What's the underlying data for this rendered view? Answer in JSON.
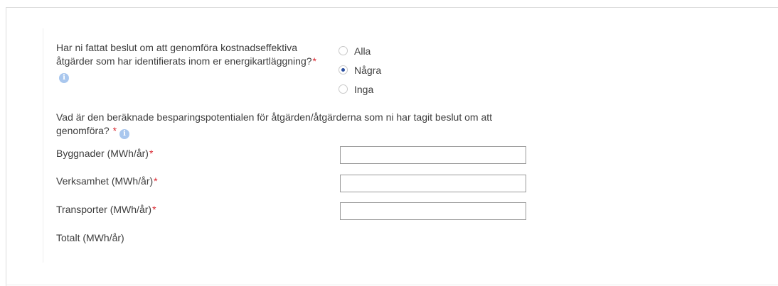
{
  "question1": {
    "text": "Har ni fattat beslut om att genomföra kostnadseffektiva åtgärder som har identifierats inom er energikartläggning?",
    "required_mark": "*",
    "options": [
      {
        "label": "Alla",
        "selected": false
      },
      {
        "label": "Några",
        "selected": true
      },
      {
        "label": "Inga",
        "selected": false
      }
    ]
  },
  "question2": {
    "text": "Vad är den beräknade besparingspotentialen för åtgärden/åtgärderna som ni har tagit beslut om att genomföra?",
    "required_mark": "*"
  },
  "fields": [
    {
      "label": "Byggnader (MWh/år)",
      "required_mark": "*",
      "value": ""
    },
    {
      "label": "Verksamhet (MWh/år)",
      "required_mark": "*",
      "value": ""
    },
    {
      "label": "Transporter (MWh/år)",
      "required_mark": "*",
      "value": ""
    }
  ],
  "total": {
    "label": "Totalt (MWh/år)"
  },
  "info_icon": {
    "glyph": "i",
    "icon": "info-icon"
  },
  "colors": {
    "required": "#d9262f",
    "info": "#a9c7ee",
    "radio_selected": "#2b4fa0",
    "text": "#3d3d3d"
  }
}
